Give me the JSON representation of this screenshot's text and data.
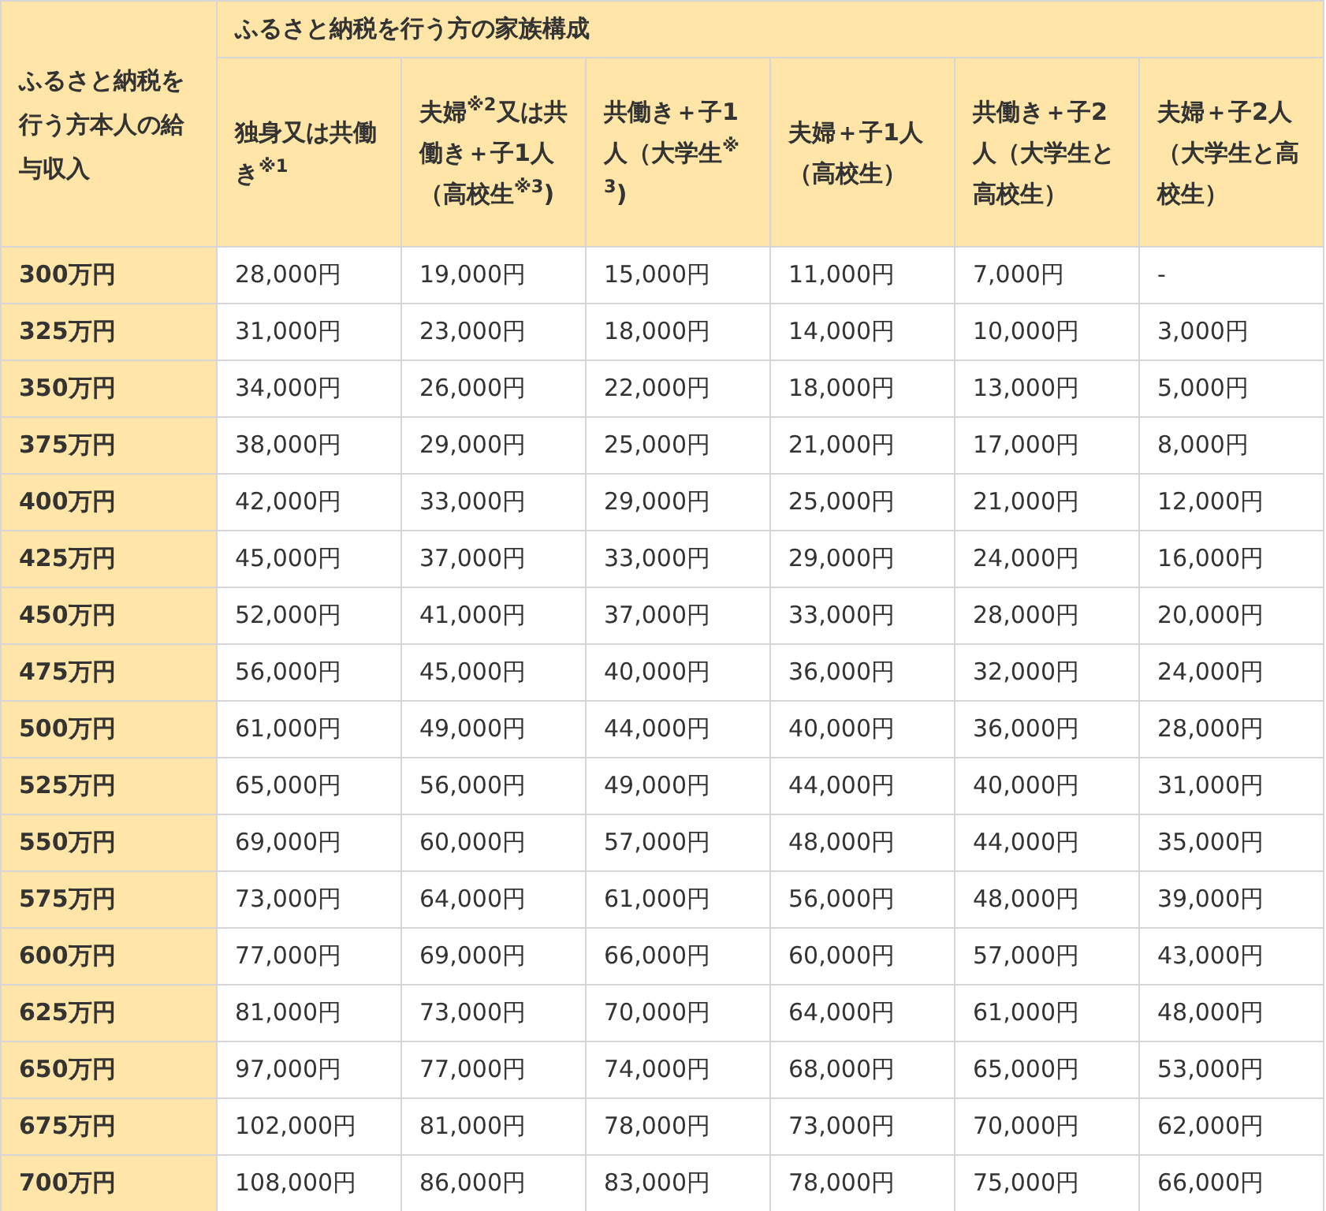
{
  "table": {
    "row_header_title": "ふるさと納税を行う方本人の給与収入",
    "group_title": "ふるさと納税を行う方の家族構成",
    "columns": [
      "独身又は共働き$^{※1}$",
      "夫婦$^{※2}$又は共働き＋子1人（高校生$^{※3}$)",
      "共働き＋子1人（大学生$^{※3}$)",
      "夫婦＋子1人（高校生）",
      "共働き＋子2人（大学生と高校生）",
      "夫婦＋子2人（大学生と高校生）"
    ],
    "rows": [
      {
        "income": "300万円",
        "values": [
          "28,000円",
          "19,000円",
          "15,000円",
          "11,000円",
          "7,000円",
          "-"
        ]
      },
      {
        "income": "325万円",
        "values": [
          "31,000円",
          "23,000円",
          "18,000円",
          "14,000円",
          "10,000円",
          "3,000円"
        ]
      },
      {
        "income": "350万円",
        "values": [
          "34,000円",
          "26,000円",
          "22,000円",
          "18,000円",
          "13,000円",
          "5,000円"
        ]
      },
      {
        "income": "375万円",
        "values": [
          "38,000円",
          "29,000円",
          "25,000円",
          "21,000円",
          "17,000円",
          "8,000円"
        ]
      },
      {
        "income": "400万円",
        "values": [
          "42,000円",
          "33,000円",
          "29,000円",
          "25,000円",
          "21,000円",
          "12,000円"
        ]
      },
      {
        "income": "425万円",
        "values": [
          "45,000円",
          "37,000円",
          "33,000円",
          "29,000円",
          "24,000円",
          "16,000円"
        ]
      },
      {
        "income": "450万円",
        "values": [
          "52,000円",
          "41,000円",
          "37,000円",
          "33,000円",
          "28,000円",
          "20,000円"
        ]
      },
      {
        "income": "475万円",
        "values": [
          "56,000円",
          "45,000円",
          "40,000円",
          "36,000円",
          "32,000円",
          "24,000円"
        ]
      },
      {
        "income": "500万円",
        "values": [
          "61,000円",
          "49,000円",
          "44,000円",
          "40,000円",
          "36,000円",
          "28,000円"
        ]
      },
      {
        "income": "525万円",
        "values": [
          "65,000円",
          "56,000円",
          "49,000円",
          "44,000円",
          "40,000円",
          "31,000円"
        ]
      },
      {
        "income": "550万円",
        "values": [
          "69,000円",
          "60,000円",
          "57,000円",
          "48,000円",
          "44,000円",
          "35,000円"
        ]
      },
      {
        "income": "575万円",
        "values": [
          "73,000円",
          "64,000円",
          "61,000円",
          "56,000円",
          "48,000円",
          "39,000円"
        ]
      },
      {
        "income": "600万円",
        "values": [
          "77,000円",
          "69,000円",
          "66,000円",
          "60,000円",
          "57,000円",
          "43,000円"
        ]
      },
      {
        "income": "625万円",
        "values": [
          "81,000円",
          "73,000円",
          "70,000円",
          "64,000円",
          "61,000円",
          "48,000円"
        ]
      },
      {
        "income": "650万円",
        "values": [
          "97,000円",
          "77,000円",
          "74,000円",
          "68,000円",
          "65,000円",
          "53,000円"
        ]
      },
      {
        "income": "675万円",
        "values": [
          "102,000円",
          "81,000円",
          "78,000円",
          "73,000円",
          "70,000円",
          "62,000円"
        ]
      },
      {
        "income": "700万円",
        "values": [
          "108,000円",
          "86,000円",
          "83,000円",
          "78,000円",
          "75,000円",
          "66,000円"
        ]
      }
    ]
  }
}
